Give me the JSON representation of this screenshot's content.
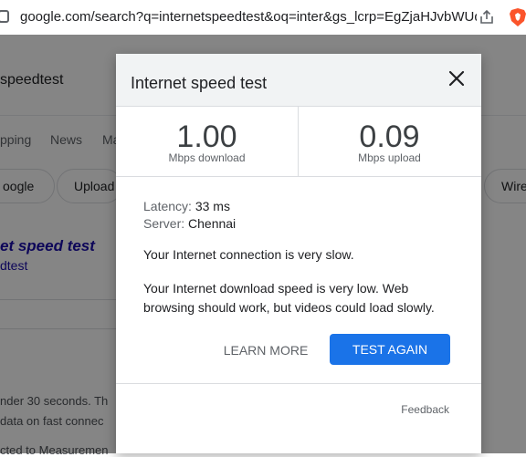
{
  "browser": {
    "url": "google.com/search?q=internetspeedtest&oq=inter&gs_lcrp=EgZjaHJvbWUqB..."
  },
  "background": {
    "query": "speedtest",
    "tabs": [
      "pping",
      "News",
      "Ma"
    ],
    "chips": [
      "oogle",
      "Upload",
      "Wire"
    ],
    "result_title": "et speed test",
    "result_sub": "dtest",
    "desc_lines": [
      "nder 30 seconds. Th",
      "data on fast connec",
      "cted to Measuremen"
    ]
  },
  "dialog": {
    "title": "Internet speed test",
    "download": {
      "value": "1.00",
      "unit": "Mbps download"
    },
    "upload": {
      "value": "0.09",
      "unit": "Mbps upload"
    },
    "latency_label": "Latency:",
    "latency_value": "33 ms",
    "server_label": "Server:",
    "server_value": "Chennai",
    "message1": "Your Internet connection is very slow.",
    "message2": "Your Internet download speed is very low. Web browsing should work, but videos could load slowly.",
    "learn_more": "LEARN MORE",
    "test_again": "TEST AGAIN",
    "feedback": "Feedback"
  },
  "colors": {
    "accent": "#1a73e8",
    "header_bg": "#f1f3f4",
    "overlay": "rgba(0,0,0,0.48)"
  }
}
